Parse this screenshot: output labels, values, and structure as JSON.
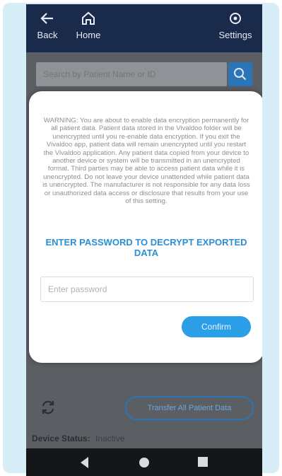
{
  "appbar": {
    "back_label": "Back",
    "home_label": "Home",
    "settings_label": "Settings"
  },
  "search": {
    "placeholder": "Search by Patient Name or ID"
  },
  "modal": {
    "warning_text": "WARNING: You are about to enable data encryption permanently for all patient data. Patient data stored in the Vivaldoo folder will be unencrypted until you re-enable data encryption. If you exit the Vivaldoo app, patient data will remain unencrypted until you restart the Vivaldoo application. Any patient data copied from your device to another device or system will be transmitted in an unencrypted format. Third parties may be able to access patient data while it is unencrypted. Do not leave your device unattended while patient data is unencrypted. The manufacturer is not responsible for any data loss or unauthorized data access or disclosure that results from your use of this setting.",
    "prompt": "ENTER PASSWORD TO DECRYPT EXPORTED DATA",
    "password_placeholder": "Enter password",
    "confirm_label": "Confirm"
  },
  "background": {
    "transfer_label": "Transfer All Patient Data",
    "status_label": "Device Status:",
    "status_value": "Inactive"
  },
  "colors": {
    "appbar": "#1a2a4b",
    "accent": "#2a9ee6",
    "prompt": "#2a8fd6"
  }
}
